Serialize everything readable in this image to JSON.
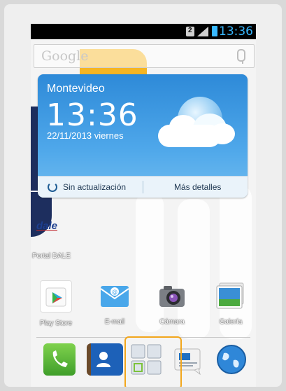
{
  "status_bar": {
    "time": "13:36",
    "sim_glyph": "2",
    "accent": "#38b8ff"
  },
  "search": {
    "logo_text": "Google"
  },
  "weather": {
    "city": "Montevideo",
    "time": "13:36",
    "date": "22/11/2013  viernes",
    "sync_label": "Sin actualización",
    "more_label": "Más detalles",
    "condition_icon": "moon-cloud-icon"
  },
  "shortcut": {
    "logo_text": "dale",
    "label": "Portal DALE"
  },
  "apps": [
    {
      "label": "Play Store",
      "icon": "play-store-icon"
    },
    {
      "label": "E-mail",
      "icon": "email-icon"
    },
    {
      "label": "Cámara",
      "icon": "camera-icon"
    },
    {
      "label": "Galería",
      "icon": "gallery-icon"
    }
  ],
  "dock": [
    {
      "icon": "phone-icon"
    },
    {
      "icon": "contacts-icon"
    },
    {
      "icon": "app-drawer-icon"
    },
    {
      "icon": "messages-icon"
    },
    {
      "icon": "browser-icon"
    }
  ],
  "colors": {
    "highlight": "#f2a61c",
    "brand_yellow": "#f5b523",
    "brand_navy": "#1d2e5e"
  }
}
